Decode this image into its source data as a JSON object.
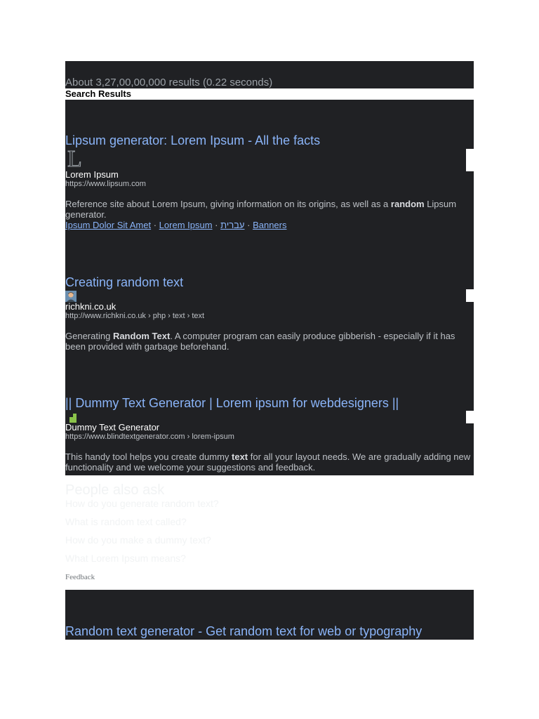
{
  "stats": "About 3,27,00,00,000 results (0.22 seconds)",
  "search_results_heading": "Search Results",
  "results": [
    {
      "title": "Lipsum generator: Lorem Ipsum - All the facts",
      "favicon_letter": "L",
      "site": "Lorem Ipsum",
      "url": "https://www.lipsum.com",
      "snippet_pre": "Reference site about Lorem Ipsum, giving information on its origins, as well as a ",
      "snippet_bold": "random",
      "snippet_post": " Lipsum generator.",
      "sitelinks": [
        "Ipsum Dolor Sit Amet",
        "Lorem Ipsum",
        "עברית",
        "Banners"
      ],
      "sitelink_separator": " · "
    },
    {
      "title": "Creating random text",
      "site": "richkni.co.uk",
      "url": "http://www.richkni.co.uk › php › text › text",
      "snippet_pre": "Generating ",
      "snippet_bold": "Random Text",
      "snippet_post": ". A computer program can easily produce gibberish - especially if it has been provided with garbage beforehand."
    },
    {
      "title": "|| Dummy Text Generator | Lorem ipsum for webdesigners ||",
      "site": "Dummy Text Generator",
      "url": "https://www.blindtextgenerator.com › lorem-ipsum",
      "snippet_pre": "This handy tool helps you create dummy ",
      "snippet_bold": "text",
      "snippet_post": " for all your layout needs. We are gradually adding new functionality and we welcome your suggestions and feedback."
    }
  ],
  "people_also_ask": {
    "title": "People also ask",
    "questions": [
      "How do you generate random text?",
      "What is random text called?",
      "How do you make a dummy text?",
      "What Lorem Ipsum means?"
    ]
  },
  "feedback": "Feedback",
  "bottom_result_title": "Random text generator - Get random text for web or typography",
  "colors": {
    "panel": "#202124",
    "link": "#8ab4f8",
    "snippet": "#bdc1c6"
  }
}
